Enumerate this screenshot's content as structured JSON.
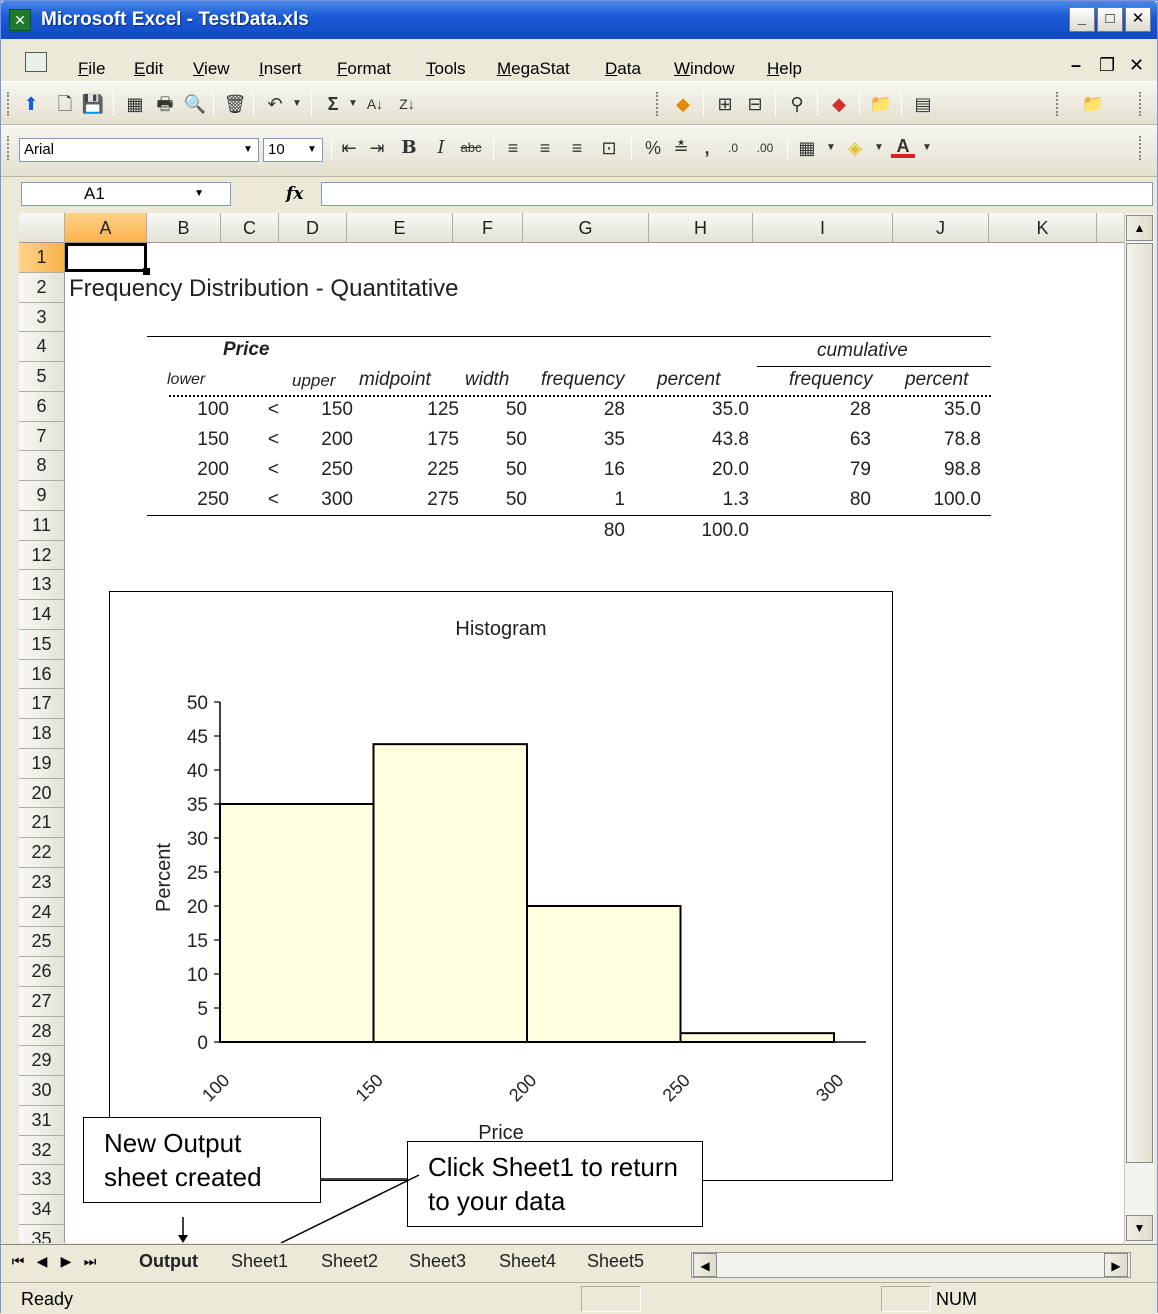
{
  "window": {
    "title": "Microsoft Excel - TestData.xls"
  },
  "menu": [
    "File",
    "Edit",
    "View",
    "Insert",
    "Format",
    "Tools",
    "MegaStat",
    "Data",
    "Window",
    "Help"
  ],
  "format_toolbar": {
    "font": "Arial",
    "size": "10"
  },
  "formula_bar": {
    "name_box": "A1",
    "fx": "fx",
    "formula": ""
  },
  "columns": [
    "A",
    "B",
    "C",
    "D",
    "E",
    "F",
    "G",
    "H",
    "I",
    "J",
    "K"
  ],
  "rows": [
    "1",
    "2",
    "3",
    "4",
    "5",
    "6",
    "7",
    "8",
    "9",
    "11",
    "12",
    "13",
    "14",
    "15",
    "16",
    "17",
    "18",
    "19",
    "20",
    "21",
    "22",
    "23",
    "24",
    "25",
    "26",
    "27",
    "28",
    "29",
    "30",
    "31",
    "32",
    "33",
    "34",
    "35"
  ],
  "sheet_title": "Frequency Distribution - Quantitative",
  "table": {
    "group_price": "Price",
    "group_cumulative": "cumulative",
    "headers": {
      "lower": "lower",
      "upper": "upper",
      "midpoint": "midpoint",
      "width": "width",
      "frequency": "frequency",
      "percent": "percent",
      "cum_frequency": "frequency",
      "cum_percent": "percent"
    },
    "rows": [
      {
        "lower": "100",
        "op": "<",
        "upper": "150",
        "midpoint": "125",
        "width": "50",
        "frequency": "28",
        "percent": "35.0",
        "cum_frequency": "28",
        "cum_percent": "35.0"
      },
      {
        "lower": "150",
        "op": "<",
        "upper": "200",
        "midpoint": "175",
        "width": "50",
        "frequency": "35",
        "percent": "43.8",
        "cum_frequency": "63",
        "cum_percent": "78.8"
      },
      {
        "lower": "200",
        "op": "<",
        "upper": "250",
        "midpoint": "225",
        "width": "50",
        "frequency": "16",
        "percent": "20.0",
        "cum_frequency": "79",
        "cum_percent": "98.8"
      },
      {
        "lower": "250",
        "op": "<",
        "upper": "300",
        "midpoint": "275",
        "width": "50",
        "frequency": "1",
        "percent": "1.3",
        "cum_frequency": "80",
        "cum_percent": "100.0"
      }
    ],
    "totals": {
      "frequency": "80",
      "percent": "100.0"
    }
  },
  "chart_data": {
    "type": "bar",
    "title": "Histogram",
    "xlabel": "Price",
    "ylabel": "Percent",
    "bin_edges": [
      100,
      150,
      200,
      250,
      300
    ],
    "values": [
      35.0,
      43.8,
      20.0,
      1.3
    ],
    "ylim": [
      0,
      50
    ],
    "yticks": [
      0,
      5,
      10,
      15,
      20,
      25,
      30,
      35,
      40,
      45,
      50
    ],
    "bar_color": "#ffffe0",
    "grid": false
  },
  "callouts": {
    "output": "New Output sheet created",
    "sheet1": "Click Sheet1 to return to your data"
  },
  "tabs": [
    "Output",
    "Sheet1",
    "Sheet2",
    "Sheet3",
    "Sheet4",
    "Sheet5"
  ],
  "status": {
    "ready": "Ready",
    "num": "NUM"
  }
}
